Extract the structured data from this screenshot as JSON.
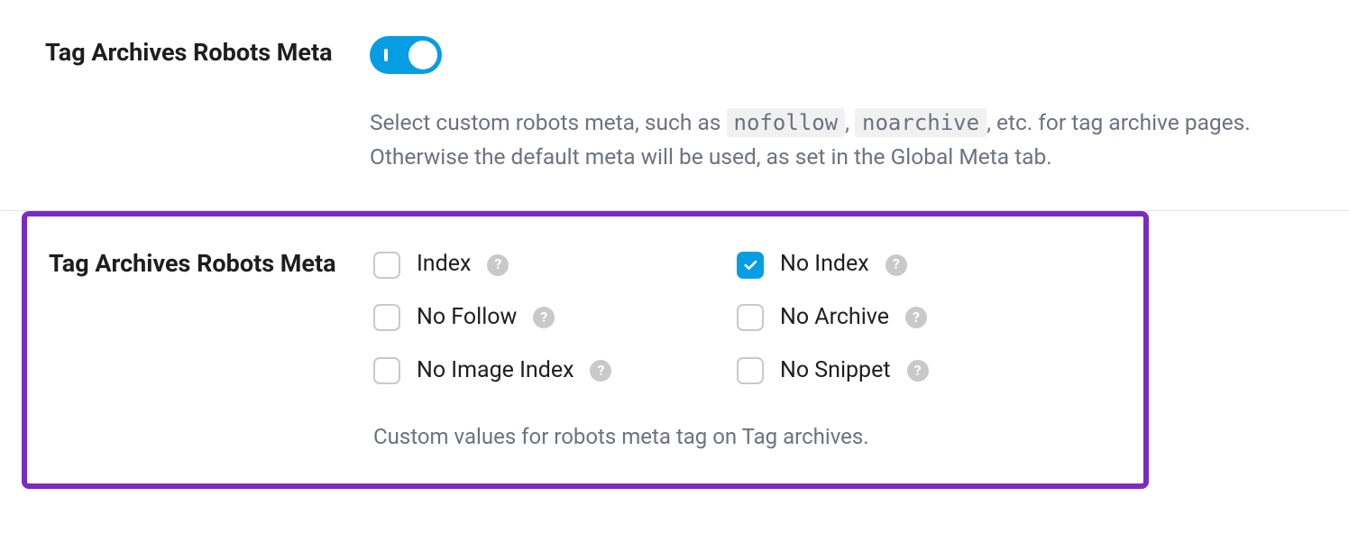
{
  "section1": {
    "title": "Tag Archives Robots Meta",
    "toggle_on": true,
    "description_parts": {
      "pre": "Select custom robots meta, such as ",
      "code1": "nofollow",
      "sep": ", ",
      "code2": "noarchive",
      "post": ", etc. for tag archive pages. Otherwise the default meta will be used, as set in the Global Meta tab."
    }
  },
  "section2": {
    "title": "Tag Archives Robots Meta",
    "checkboxes": [
      {
        "label": "Index",
        "checked": false
      },
      {
        "label": "No Index",
        "checked": true
      },
      {
        "label": "No Follow",
        "checked": false
      },
      {
        "label": "No Archive",
        "checked": false
      },
      {
        "label": "No Image Index",
        "checked": false
      },
      {
        "label": "No Snippet",
        "checked": false
      }
    ],
    "description": "Custom values for robots meta tag on Tag archives."
  },
  "glyphs": {
    "help": "?"
  }
}
